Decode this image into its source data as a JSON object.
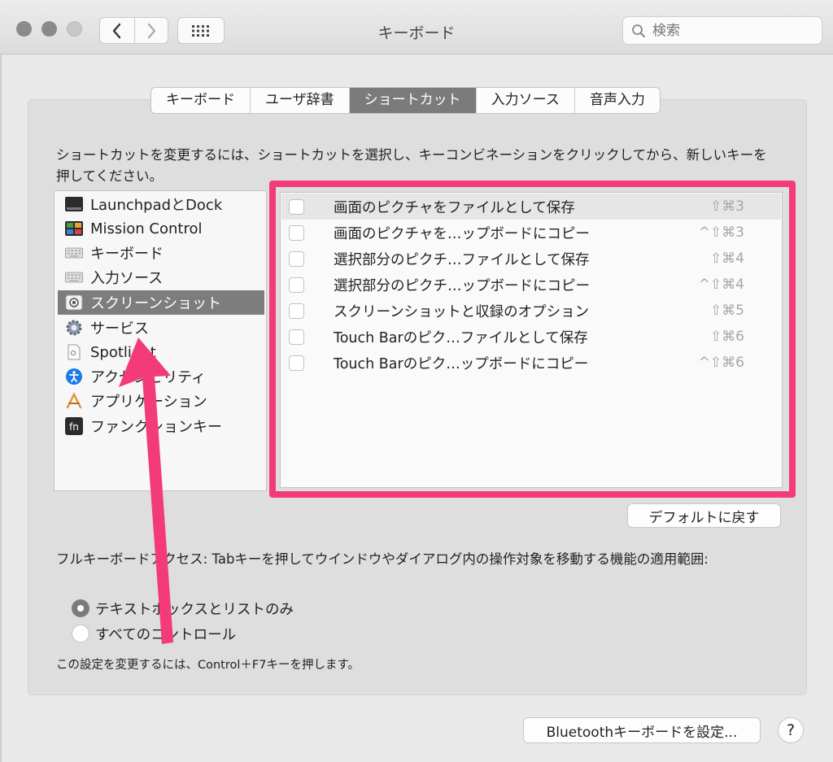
{
  "window": {
    "title": "キーボード",
    "search_placeholder": "検索"
  },
  "tabs": [
    {
      "label": "キーボード",
      "active": false
    },
    {
      "label": "ユーザ辞書",
      "active": false
    },
    {
      "label": "ショートカット",
      "active": true
    },
    {
      "label": "入力ソース",
      "active": false
    },
    {
      "label": "音声入力",
      "active": false
    }
  ],
  "instruction": "ショートカットを変更するには、ショートカットを選択し、キーコンビネーションをクリックしてから、新しいキーを押してください。",
  "categories": [
    {
      "label": "LaunchpadとDock",
      "icon": "launchpad-dock-icon"
    },
    {
      "label": "Mission Control",
      "icon": "mission-control-icon"
    },
    {
      "label": "キーボード",
      "icon": "keyboard-icon"
    },
    {
      "label": "入力ソース",
      "icon": "input-source-icon"
    },
    {
      "label": "スクリーンショット",
      "icon": "screenshot-icon",
      "selected": true
    },
    {
      "label": "サービス",
      "icon": "gear-icon"
    },
    {
      "label": "Spotlight",
      "icon": "spotlight-icon"
    },
    {
      "label": "アクセシビリティ",
      "icon": "accessibility-icon"
    },
    {
      "label": "アプリケーション",
      "icon": "app-store-icon"
    },
    {
      "label": "ファンクションキー",
      "icon": "fn-key-icon"
    }
  ],
  "shortcuts": [
    {
      "label": "画面のピクチャをファイルとして保存",
      "keys": "⇧⌘3",
      "checked": false
    },
    {
      "label": "画面のピクチャを…ップボードにコピー",
      "keys": "^⇧⌘3",
      "checked": false
    },
    {
      "label": "選択部分のピクチ…ファイルとして保存",
      "keys": "⇧⌘4",
      "checked": false
    },
    {
      "label": "選択部分のピクチ…ップボードにコピー",
      "keys": "^⇧⌘4",
      "checked": false
    },
    {
      "label": "スクリーンショットと収録のオプション",
      "keys": "⇧⌘5",
      "checked": false
    },
    {
      "label": "Touch Barのピク…ファイルとして保存",
      "keys": "⇧⌘6",
      "checked": false
    },
    {
      "label": "Touch Barのピク…ップボードにコピー",
      "keys": "^⇧⌘6",
      "checked": false
    }
  ],
  "restore_defaults_label": "デフォルトに戻す",
  "full_keyboard_access": "フルキーボードアクセス: Tabキーを押してウインドウやダイアログ内の操作対象を移動する機能の適用範囲:",
  "radio_options": [
    {
      "label": "テキストボックスとリストのみ",
      "selected": true
    },
    {
      "label": "すべてのコントロール",
      "selected": false
    }
  ],
  "note": "この設定を変更するには、Control＋F7キーを押します。",
  "bluetooth_button_label": "Bluetoothキーボードを設定...",
  "help_label": "?",
  "colors": {
    "annotation": "#f33b7a",
    "selected_gray": "#7b7b7b"
  }
}
